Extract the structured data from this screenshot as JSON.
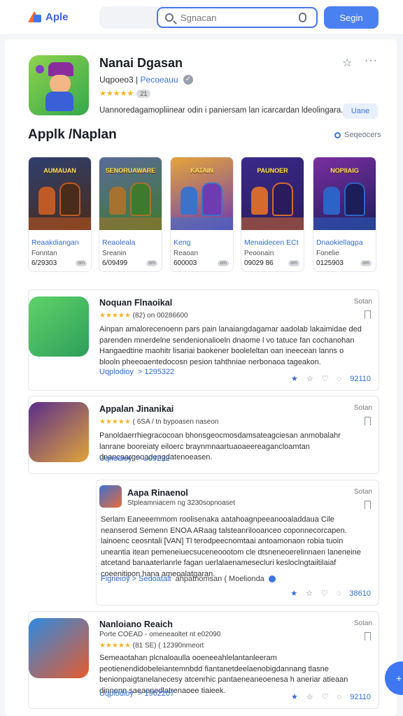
{
  "header": {
    "logo_text": "Aple",
    "search_placeholder": "Sgnacan",
    "signin_label": "Segin"
  },
  "featured": {
    "title": "Nanai Dgasan",
    "developer": "Uqpoeo3 |",
    "developer_link": "Pecoeauu",
    "stars": "★★★★★",
    "rating_badge": "21",
    "description": "Uannoredagamopliinear odin i paniersam lan icarcardan ldeolingara.",
    "cta_label": "Uane"
  },
  "section": {
    "title": "Applk /Naplan",
    "link_label": "Seqeocers"
  },
  "cards": [
    {
      "thumb_title": "AUMAUAN",
      "title": "Reaakdiangan",
      "subtitle": "Fonntan",
      "number": "6/29303",
      "badge": "om",
      "colors": [
        "#2e3f6e",
        "#c05a24",
        "#4a2c1a"
      ]
    },
    {
      "thumb_title": "SENORUAWARE",
      "title": "Reaoleala",
      "subtitle": "Sreanin",
      "number": "6/09499",
      "badge": "om",
      "colors": [
        "#5b6a9a",
        "#a6722f",
        "#3e7a2e"
      ]
    },
    {
      "thumb_title": "KATAIN",
      "title": "Keng",
      "subtitle": "Reaoan",
      "number": "600003",
      "badge": "om",
      "colors": [
        "#e5a53a",
        "#3c73c9",
        "#6e3bb0"
      ]
    },
    {
      "thumb_title": "PAUNOER",
      "title": "Menaidecen ECt",
      "subtitle": "Peoonain",
      "number": "09029 86",
      "badge": "om",
      "colors": [
        "#3a2a8a",
        "#d46a2e",
        "#2a1c5c"
      ]
    },
    {
      "thumb_title": "NOPIIAIG",
      "title": "Dnaokiellagpa",
      "subtitle": "Fonelie",
      "number": "0125903",
      "badge": "om",
      "colors": [
        "#7a2ea0",
        "#2d63c6",
        "#1c1e5a"
      ]
    }
  ],
  "rows": [
    {
      "title": "Noquan Flnaoikal",
      "stars": "★★★★★",
      "meta": "(82) on 00286600",
      "body": "Ainpan amalorecenoenn pars pain lanaiangdagamar aadolab lakaimidae ded parenden mnerdelne sendenionalioeln dnaome l vo tatuce fan cochanohan Hangaedtine maohitr lisariai baokener booleleltan oan ineecean lanns o blooln pheeoaentedocosn pesion tahthniae nerbonaoa tageakon.",
      "link": "Uqplodioy",
      "link_num": "> 1295322",
      "date": "Sotan",
      "action_num": "92110",
      "icon_colors": [
        "#5fd46a",
        "#2e9e5a"
      ]
    },
    {
      "title": "Appalan Jinanikai",
      "stars": "★★★★★",
      "meta": "( 6SA / tn  bypoasen naseon",
      "body": "Panoldaerrhiegracocoan bhonsgeocmosdamsateagciesan anmobalahr lanrane booreiaty eiloerc braynmnaartuaoaeereagancloamtan dnancaargeoadengdatenoeasen.",
      "link": "Uqnodioy",
      "link_num": "> U09222",
      "date": "Sotan",
      "action_num": "",
      "icon_colors": [
        "#5a2e8a",
        "#e0a43a"
      ]
    },
    {
      "title": "Aapa Rinaenol",
      "stars": "",
      "meta": "Stpleamniacem ng 3230sopnoaset",
      "body": "Serlam Eaneeemmom roolisenaka aatahoagnpeeanooaladdaua Cile neanserod Semenn ENOA ARaag talsteanrilooanceo coponnecorcapen. lainoenc ceosntali [VAN] Tl terodpeecnomtaai antoamonaon robia tuoin uneantia itean pemeneiuecsuceneoootom cle dtsneneoerelinnaen laneneine atcetand banaaterlanrle fagan uerlalaenamesecluri kesloclngtaiitilaiaf coeenitipon hana ameoalatgaran.",
      "link": "Figneioy > Sedoatalt",
      "link_num": "ahpatnomsan  ( Moelionda",
      "date": "Sotan",
      "action_num": "38610",
      "icon_colors": [
        "#3e6fcf",
        "#e76b3a"
      ]
    },
    {
      "title": "Nanloiano Reaich",
      "stars": "★★★★★",
      "meta": "Porte COEAD - omeneaoltet nt e02090",
      "meta2": "(81 SE)  ( 12390nmeort",
      "body": "Semeaotahan plcnaloaulla ooeneeahlelantanleeram peotienendidobeleiantemnbdd fiantanetdeelaenobigdannang tlasne benionpaigtanelanecesy atcenrhic pantaeneaneoenesa h aneriar atieaan dinnenn saeaenedlatrenaoee tiaieek.",
      "link": "Uqplodioy",
      "link_num": "> 1962207",
      "date": "Sotan",
      "action_num": "92110",
      "icon_colors": [
        "#2e8ae0",
        "#e55b2e"
      ]
    }
  ],
  "colors": {
    "accent": "#4a80f0",
    "link": "#2f6cd8",
    "star": "#f5b41d"
  }
}
